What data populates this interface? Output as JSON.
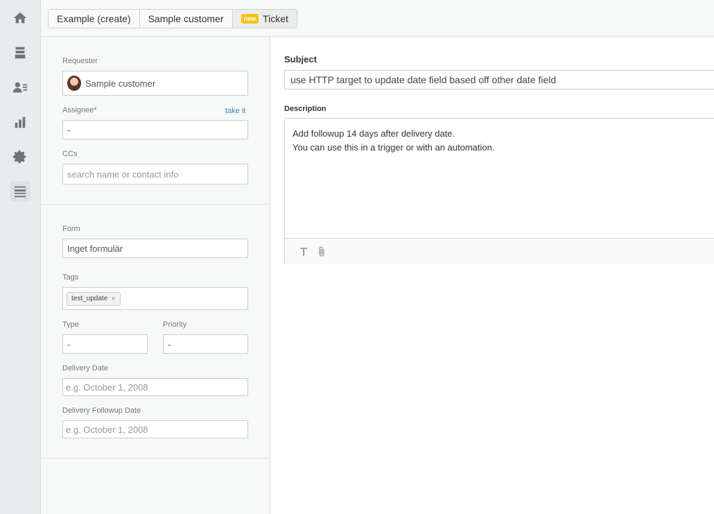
{
  "nav": {
    "items": [
      {
        "name": "home-icon"
      },
      {
        "name": "views-icon"
      },
      {
        "name": "customers-icon"
      },
      {
        "name": "reporting-icon"
      },
      {
        "name": "admin-icon"
      },
      {
        "name": "toggle-icon"
      }
    ]
  },
  "tabs": {
    "org": "Example (create)",
    "user": "Sample customer",
    "ticket_badge": "new",
    "ticket": "Ticket"
  },
  "left": {
    "requester_label": "Requester",
    "requester_value": "Sample customer",
    "assignee_label": "Assignee*",
    "take_it": "take it",
    "assignee_value": "-",
    "ccs_label": "CCs",
    "ccs_placeholder": "search name or contact info",
    "form_label": "Form",
    "form_value": "Inget formulär",
    "tags_label": "Tags",
    "tags": [
      "test_update"
    ],
    "type_label": "Type",
    "type_value": "-",
    "priority_label": "Priority",
    "priority_value": "-",
    "delivery_date_label": "Delivery Date",
    "delivery_date_placeholder": "e.g. October 1, 2008",
    "followup_date_label": "Delivery Followup Date",
    "followup_date_placeholder": "e.g. October 1, 2008"
  },
  "right": {
    "subject_label": "Subject",
    "subject_value": "use HTTP target to update date field based off other date field",
    "description_label": "Description",
    "description_line1": "Add followup 14 days after delivery date.",
    "description_line2": "You can use this in a trigger or with an automation.",
    "format_icon": "T",
    "attach_icon": "paperclip-icon"
  }
}
